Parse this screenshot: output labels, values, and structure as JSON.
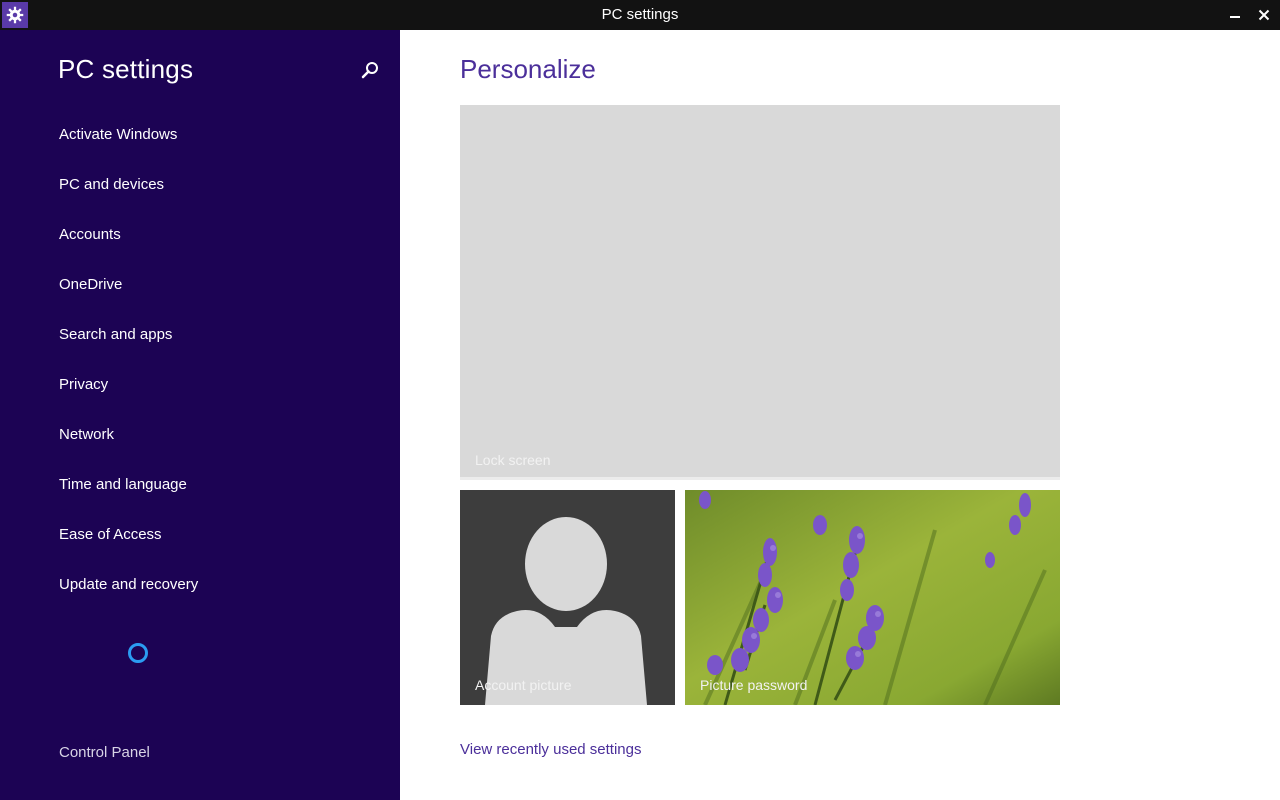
{
  "window": {
    "title": "PC settings",
    "app_icon": "gear-icon",
    "minimize_icon": "minimize-icon",
    "close_icon": "close-icon"
  },
  "sidebar": {
    "title": "PC settings",
    "search_icon": "search-icon",
    "background": "#1c0354",
    "items": [
      {
        "label": "Activate Windows"
      },
      {
        "label": "PC and devices"
      },
      {
        "label": "Accounts"
      },
      {
        "label": "OneDrive"
      },
      {
        "label": "Search and apps"
      },
      {
        "label": "Privacy"
      },
      {
        "label": "Network"
      },
      {
        "label": "Time and language"
      },
      {
        "label": "Ease of Access"
      },
      {
        "label": "Update and recovery"
      }
    ],
    "loading_indicator": "spinner",
    "footer_link": "Control Panel"
  },
  "main": {
    "title": "Personalize",
    "accent": "#4b2f9a",
    "tiles": {
      "lock_screen": "Lock screen",
      "account_picture": "Account picture",
      "picture_password": "Picture password"
    },
    "footer_link": "View recently used settings"
  }
}
